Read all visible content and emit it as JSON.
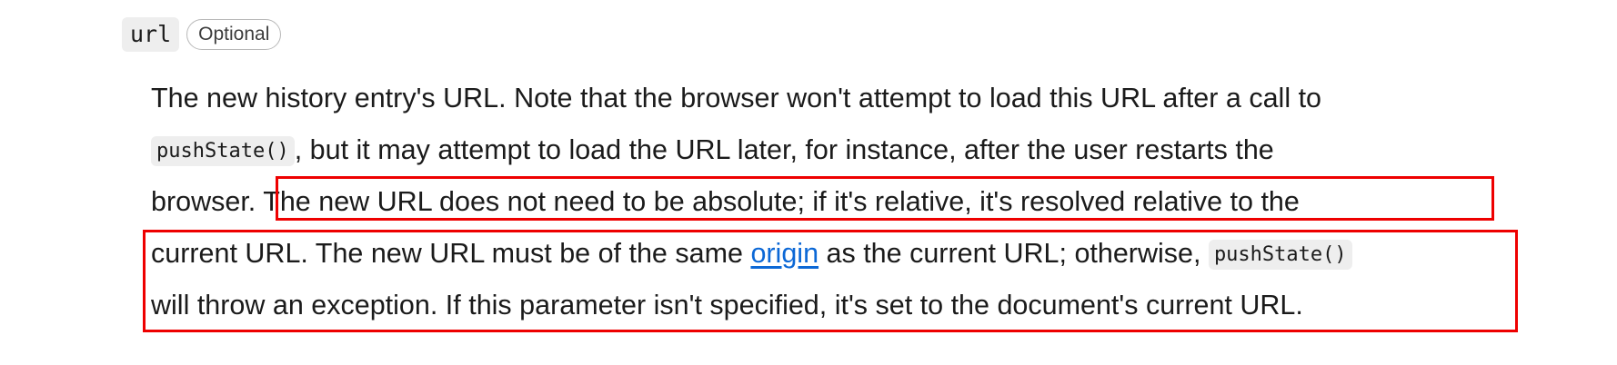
{
  "param": {
    "name": "url",
    "badge": "Optional"
  },
  "description": {
    "line1": "The new history entry's URL. Note that the browser won't attempt to load this URL after a call to",
    "line2_code": "pushState()",
    "line2_text": ", but it may attempt to load the URL later, for instance, after the user restarts the",
    "line3_a": "browser. ",
    "line3_b": "The new URL does not need to be absolute; if it's relative, it's resolved relative to the",
    "line4_a": "current URL. The new URL must be of the same ",
    "line4_link": "origin",
    "line4_b": " as the current URL; otherwise, ",
    "line4_code": "pushState()",
    "line5": "will throw an exception. If this parameter isn't specified, it's set to the document's current URL."
  },
  "colors": {
    "highlight_border": "#ee0000",
    "link": "#0c68d6",
    "code_background": "#eeeeee"
  }
}
